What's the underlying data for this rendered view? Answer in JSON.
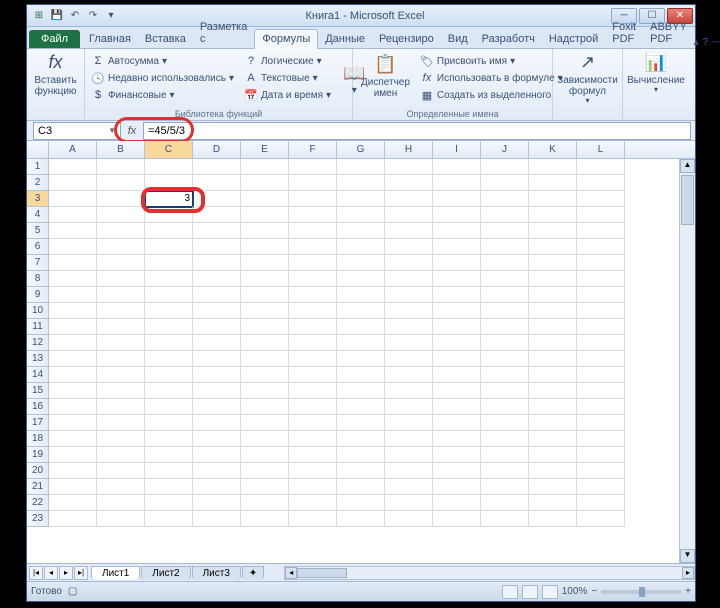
{
  "titlebar": {
    "doc": "Книга1",
    "app": "Microsoft Excel"
  },
  "tabs": {
    "file": "Файл",
    "items": [
      "Главная",
      "Вставка",
      "Разметка с",
      "Формулы",
      "Данные",
      "Рецензиро",
      "Вид",
      "Разработч",
      "Надстрой",
      "Foxit PDF",
      "ABBYY PDF"
    ],
    "active_index": 3
  },
  "ribbon": {
    "insert_fn": "Вставить\nфункцию",
    "fx_lib": {
      "autosum": "Автосумма",
      "recent": "Недавно использовались",
      "financial": "Финансовые",
      "logical": "Логические",
      "text": "Текстовые",
      "datetime": "Дата и время",
      "group_label": "Библиотека функций"
    },
    "names": {
      "manager": "Диспетчер\nимен",
      "assign": "Присвоить имя",
      "use_in_formula": "Использовать в формуле",
      "create_from": "Создать из выделенного",
      "group_label": "Определенные имена"
    },
    "deps": "Зависимости\nформул",
    "calc": "Вычисление"
  },
  "formula_bar": {
    "cell_ref": "C3",
    "formula": "=45/5/3"
  },
  "grid": {
    "columns": [
      "A",
      "B",
      "C",
      "D",
      "E",
      "F",
      "G",
      "H",
      "I",
      "J",
      "K",
      "L"
    ],
    "rows": 23,
    "active_col": "C",
    "active_row": 3,
    "selected_cell": {
      "col": "C",
      "row": 3,
      "value": "3"
    }
  },
  "sheets": {
    "items": [
      "Лист1",
      "Лист2",
      "Лист3"
    ],
    "active_index": 0
  },
  "statusbar": {
    "ready": "Готово",
    "zoom": "100%"
  },
  "chart_data": null
}
